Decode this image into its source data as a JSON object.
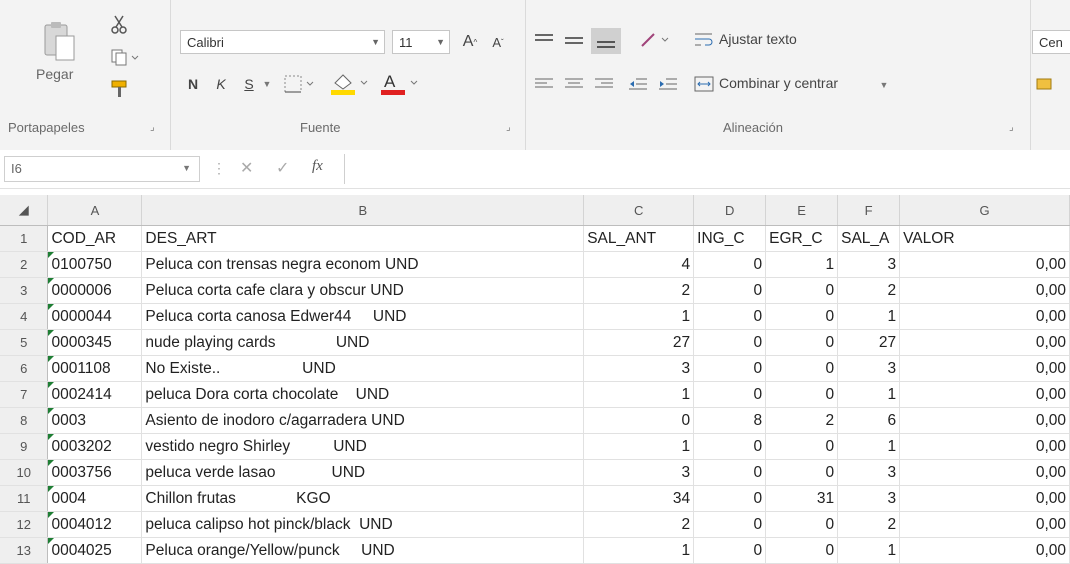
{
  "ribbon": {
    "clipboard": {
      "paste_label": "Pegar",
      "group_label": "Portapapeles"
    },
    "font": {
      "name": "Calibri",
      "size": "11",
      "bold": "N",
      "italic": "K",
      "underline": "S",
      "group_label": "Fuente"
    },
    "alignment": {
      "wrap_text": "Ajustar texto",
      "merge_center": "Combinar y centrar",
      "group_label": "Alineación"
    },
    "number": {
      "format_partial": "Cen"
    }
  },
  "formula_bar": {
    "name_box": "I6",
    "fx": "fx",
    "value": ""
  },
  "sheet": {
    "columns": [
      "A",
      "B",
      "C",
      "D",
      "E",
      "F",
      "G"
    ],
    "headers": [
      "COD_AR",
      "DES_ART",
      "SAL_ANT",
      "ING_C",
      "EGR_C",
      "SAL_A",
      "VALOR"
    ],
    "rows": [
      {
        "n": "2",
        "a": "0100750",
        "b": "Peluca con trensas negra econom UND",
        "c": "4",
        "d": "0",
        "e": "1",
        "f": "3",
        "g": "0,00"
      },
      {
        "n": "3",
        "a": "0000006",
        "b": "Peluca corta cafe clara y obscur UND",
        "c": "2",
        "d": "0",
        "e": "0",
        "f": "2",
        "g": "0,00"
      },
      {
        "n": "4",
        "a": "0000044",
        "b": "Peluca corta canosa Edwer44     UND",
        "c": "1",
        "d": "0",
        "e": "0",
        "f": "1",
        "g": "0,00"
      },
      {
        "n": "5",
        "a": "0000345",
        "b": "nude playing cards              UND",
        "c": "27",
        "d": "0",
        "e": "0",
        "f": "27",
        "g": "0,00"
      },
      {
        "n": "6",
        "a": "0001108",
        "b": "No Existe..                   UND",
        "c": "3",
        "d": "0",
        "e": "0",
        "f": "3",
        "g": "0,00"
      },
      {
        "n": "7",
        "a": "0002414",
        "b": "peluca Dora corta chocolate    UND",
        "c": "1",
        "d": "0",
        "e": "0",
        "f": "1",
        "g": "0,00"
      },
      {
        "n": "8",
        "a": "0003",
        "b": "Asiento de inodoro c/agarradera UND",
        "c": "0",
        "d": "8",
        "e": "2",
        "f": "6",
        "g": "0,00"
      },
      {
        "n": "9",
        "a": "0003202",
        "b": "vestido negro Shirley          UND",
        "c": "1",
        "d": "0",
        "e": "0",
        "f": "1",
        "g": "0,00"
      },
      {
        "n": "10",
        "a": "0003756",
        "b": "peluca verde lasao             UND",
        "c": "3",
        "d": "0",
        "e": "0",
        "f": "3",
        "g": "0,00"
      },
      {
        "n": "11",
        "a": "0004",
        "b": "Chillon frutas              KGO",
        "c": "34",
        "d": "0",
        "e": "31",
        "f": "3",
        "g": "0,00"
      },
      {
        "n": "12",
        "a": "0004012",
        "b": "peluca calipso hot pinck/black  UND",
        "c": "2",
        "d": "0",
        "e": "0",
        "f": "2",
        "g": "0,00"
      },
      {
        "n": "13",
        "a": "0004025",
        "b": "Peluca orange/Yellow/punck     UND",
        "c": "1",
        "d": "0",
        "e": "0",
        "f": "1",
        "g": "0,00"
      }
    ]
  },
  "colors": {
    "ribbon_bg": "#f3f3f3",
    "header_bg": "#efefef",
    "font_red": "#e02020",
    "fill_yellow": "#ffd900",
    "error_triangle": "#1e7e34"
  },
  "icons": [
    "paste-icon",
    "cut-icon",
    "copy-icon",
    "format-painter-icon",
    "font-color-icon",
    "fill-color-icon"
  ]
}
